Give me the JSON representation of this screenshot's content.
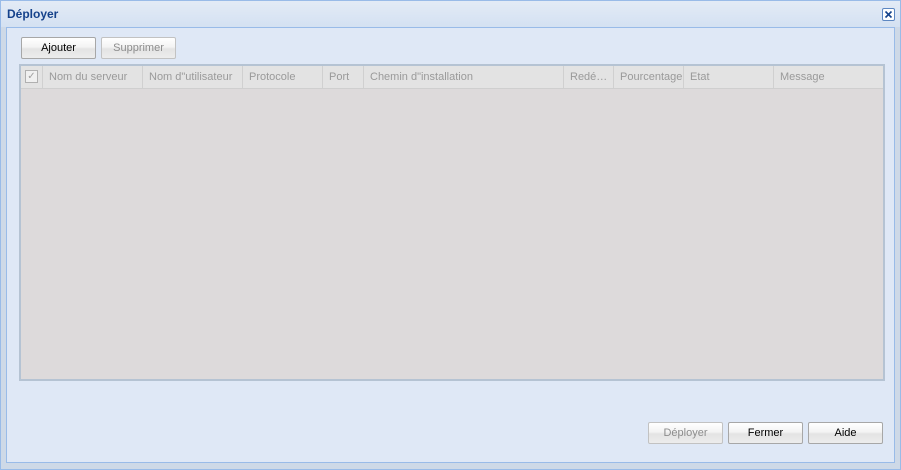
{
  "window": {
    "title": "Déployer",
    "close_icon": "close-icon"
  },
  "toolbar": {
    "add_label": "Ajouter",
    "remove_label": "Supprimer"
  },
  "grid": {
    "checkbox_glyph": "✓",
    "columns": [
      "Nom du serveur",
      "Nom d\"utilisateur",
      "Protocole",
      "Port",
      "Chemin d\"installation",
      "Redé…",
      "Pourcentage",
      "Etat",
      "Message"
    ],
    "rows": []
  },
  "footer": {
    "deploy_label": "Déployer",
    "close_label": "Fermer",
    "help_label": "Aide"
  },
  "colors": {
    "title": "#15428b",
    "frame": "#99bbe8",
    "body": "#dfe8f6",
    "grid_bg": "#dddadb"
  }
}
